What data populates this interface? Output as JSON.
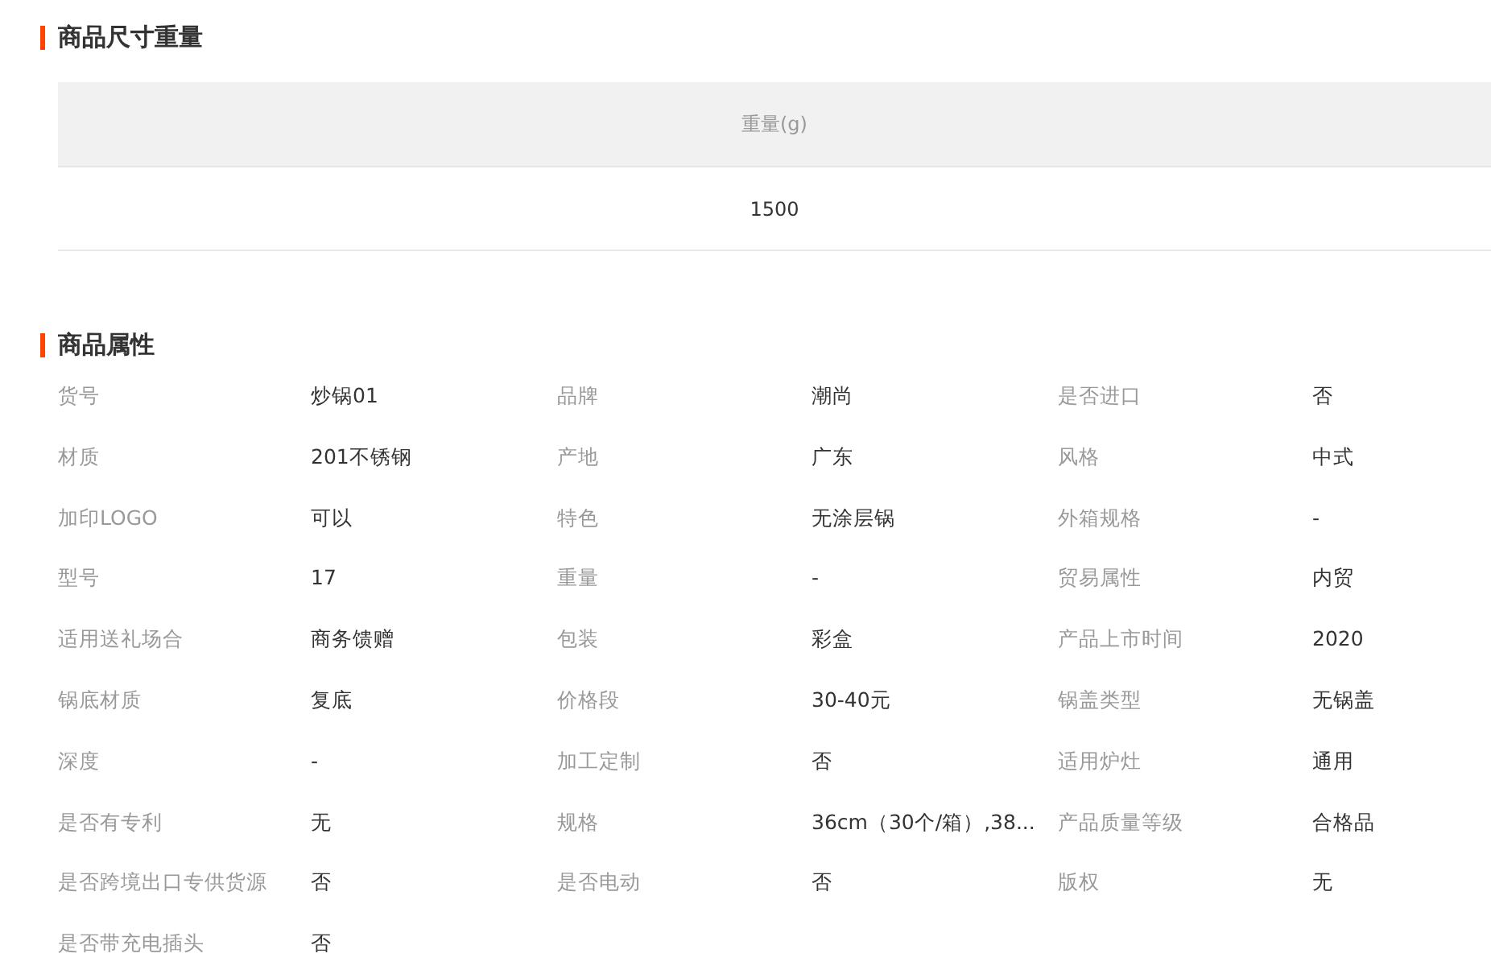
{
  "size_section": {
    "title": "商品尺寸重量",
    "table": {
      "columns": [
        "重量(g)"
      ],
      "rows": [
        [
          "1500"
        ]
      ]
    }
  },
  "attributes_section": {
    "title": "商品属性",
    "attributes": [
      {
        "label": "货号",
        "value": "炒锅01"
      },
      {
        "label": "品牌",
        "value": "潮尚"
      },
      {
        "label": "是否进口",
        "value": "否"
      },
      {
        "label": "材质",
        "value": "201不锈钢"
      },
      {
        "label": "产地",
        "value": "广东"
      },
      {
        "label": "风格",
        "value": "中式"
      },
      {
        "label": "加印LOGO",
        "value": "可以"
      },
      {
        "label": "特色",
        "value": "无涂层锅"
      },
      {
        "label": "外箱规格",
        "value": "-"
      },
      {
        "label": "型号",
        "value": "17"
      },
      {
        "label": "重量",
        "value": "-"
      },
      {
        "label": "贸易属性",
        "value": "内贸"
      },
      {
        "label": "适用送礼场合",
        "value": "商务馈赠"
      },
      {
        "label": "包装",
        "value": "彩盒"
      },
      {
        "label": "产品上市时间",
        "value": "2020"
      },
      {
        "label": "锅底材质",
        "value": "复底"
      },
      {
        "label": "价格段",
        "value": "30-40元"
      },
      {
        "label": "锅盖类型",
        "value": "无锅盖"
      },
      {
        "label": "深度",
        "value": "-"
      },
      {
        "label": "加工定制",
        "value": "否"
      },
      {
        "label": "适用炉灶",
        "value": "通用"
      },
      {
        "label": "是否有专利",
        "value": "无"
      },
      {
        "label": "规格",
        "value": "36cm（30个/箱）,38..."
      },
      {
        "label": "产品质量等级",
        "value": "合格品"
      },
      {
        "label": "是否跨境出口专供货源",
        "value": "否"
      },
      {
        "label": "是否电动",
        "value": "否"
      },
      {
        "label": "版权",
        "value": "无"
      },
      {
        "label": "是否带充电插头",
        "value": "否"
      }
    ]
  }
}
